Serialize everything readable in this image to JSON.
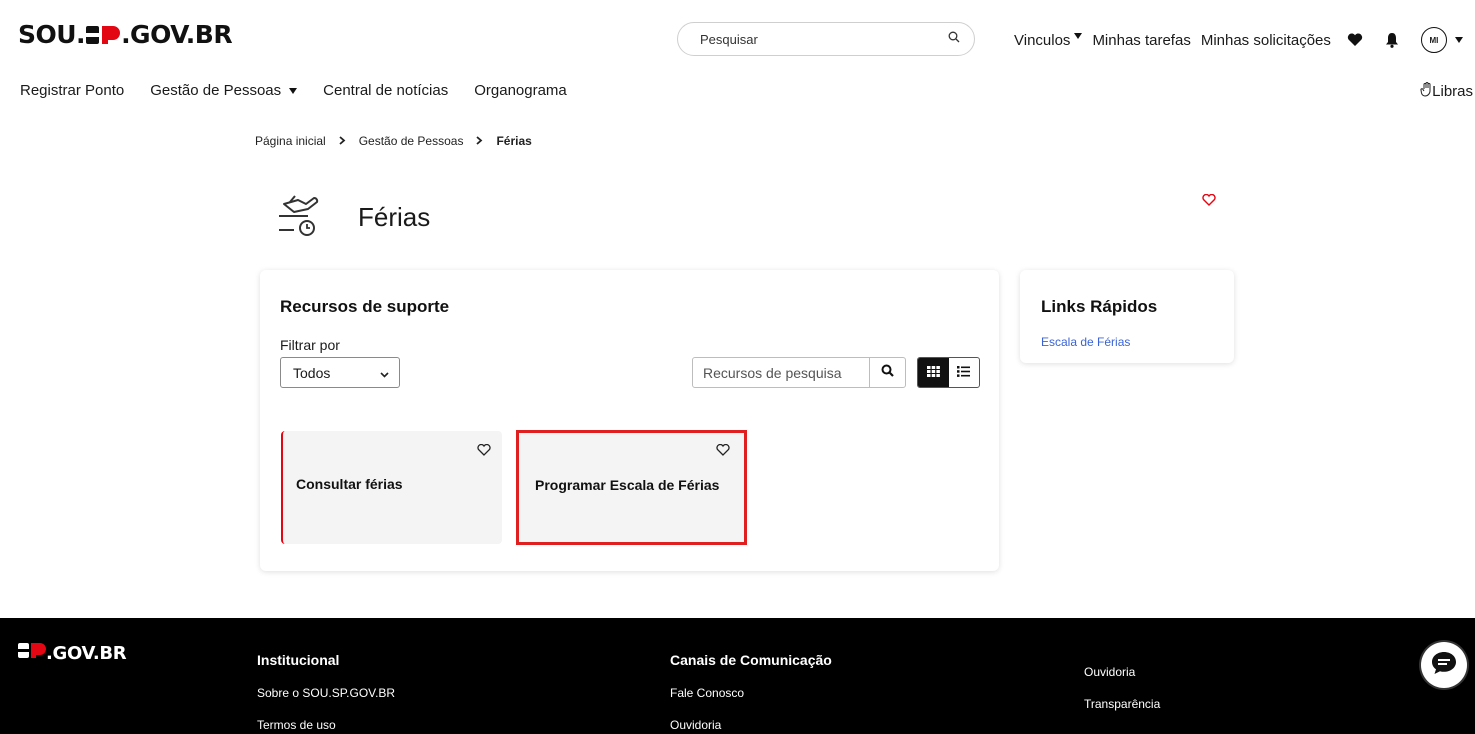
{
  "header": {
    "logo": {
      "left": "SOU.",
      "right": ".GOV.BR",
      "mark_color": "#e30613"
    },
    "search_placeholder": "Pesquisar",
    "top_links": [
      "Vinculos",
      "Minhas tarefas",
      "Minhas solicitações"
    ],
    "avatar_initials": "MI"
  },
  "nav": {
    "items": [
      "Registrar Ponto",
      "Gestão de Pessoas",
      "Central de notícias",
      "Organograma"
    ],
    "libras": "Libras"
  },
  "breadcrumb": [
    "Página inicial",
    "Gestão de Pessoas",
    "Férias"
  ],
  "page": {
    "title": "Férias",
    "icon": "vacation-plane-clock-icon",
    "accent_color": "#e30613"
  },
  "resources": {
    "title": "Recursos de suporte",
    "filter_label": "Filtrar por",
    "filter_value": "Todos",
    "search_placeholder": "Recursos de pesquisa",
    "tiles": [
      {
        "label": "Consultar férias"
      },
      {
        "label": "Programar Escala de Férias"
      }
    ]
  },
  "quick_links": {
    "title": "Links Rápidos",
    "links": [
      "Escala de Férias"
    ]
  },
  "footer": {
    "logo": ".GOV.BR",
    "institucional": {
      "title": "Institucional",
      "links": [
        "Sobre o SOU.SP.GOV.BR",
        "Termos de uso"
      ]
    },
    "canais": {
      "title": "Canais de Comunicação",
      "links": [
        "Fale Conosco",
        "Ouvidoria"
      ]
    },
    "extra": {
      "links": [
        "Ouvidoria",
        "Transparência"
      ]
    }
  }
}
